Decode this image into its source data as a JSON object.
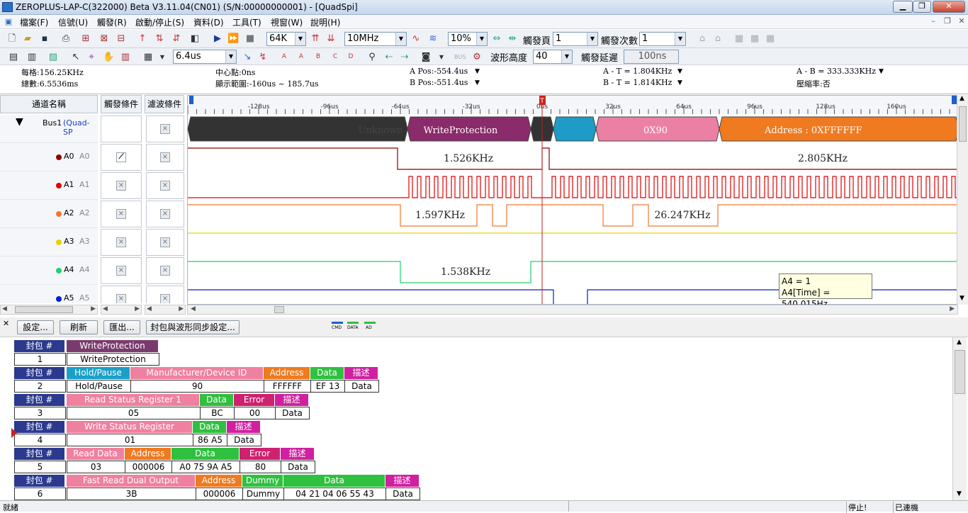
{
  "window": {
    "title": "ZEROPLUS-LAP-C(322000) Beta V3.11.04(CN01) (S/N:00000000001) - [QuadSpi]"
  },
  "menu": [
    "檔案(F)",
    "信號(U)",
    "觸發(R)",
    "啟動/停止(S)",
    "資料(D)",
    "工具(T)",
    "視窗(W)",
    "說明(H)"
  ],
  "toolbar": {
    "memory": "64K",
    "samplerate": "10MHz",
    "zoom": "10%",
    "trigger_page_label": "觸發頁",
    "trigger_page": "1",
    "trigger_count_label": "觸發次數",
    "trigger_count": "1",
    "time_per_div": "6.4us",
    "wave_height_label": "波形高度",
    "wave_height": "40",
    "trigger_delay_label": "觸發延遲",
    "trigger_delay": "100ns"
  },
  "info": {
    "period": "每格:156.25KHz",
    "total": "總數:6.5536ms",
    "center": "中心點:0ns",
    "range": "顯示範圍:-160us ~ 185.7us",
    "apos": "A Pos:-554.4us",
    "bpos": "B Pos:-551.4us",
    "at": "A - T = 1.804KHz",
    "bt": "B - T = 1.814KHz",
    "ab": "A - B = 333.333KHz",
    "compress": "壓縮率:否"
  },
  "columns": {
    "name": "通道名稱",
    "trigger": "觸發條件",
    "filter": "濾波條件"
  },
  "bus": {
    "name": "Bus1",
    "type": "(Quad-SP"
  },
  "channels": [
    {
      "label": "A0",
      "alias": "A0",
      "color": "#8b0000"
    },
    {
      "label": "A1",
      "alias": "A1",
      "color": "#e00000"
    },
    {
      "label": "A2",
      "alias": "A2",
      "color": "#f07830"
    },
    {
      "label": "A3",
      "alias": "A3",
      "color": "#e8d000"
    },
    {
      "label": "A4",
      "alias": "A4",
      "color": "#20d070"
    },
    {
      "label": "A5",
      "alias": "A5",
      "color": "#0020d0"
    }
  ],
  "ruler": [
    "-128us",
    "-96us",
    "-64us",
    "-32us",
    "0us",
    "32us",
    "64us",
    "96us",
    "128us",
    "160us"
  ],
  "ruler_values_us": [
    -128,
    -96,
    -64,
    -32,
    0,
    32,
    64,
    96,
    128,
    160
  ],
  "bus_segments": [
    "Unknown",
    "WriteProtection",
    "0X90",
    "Address : 0XFFFFFF"
  ],
  "freq_labels": {
    "a0_left": "1.526KHz",
    "a0_right": "2.805KHz",
    "a2_left": "1.597KHz",
    "a2_right": "26.247KHz",
    "a4": "1.538KHz"
  },
  "tooltip": {
    "line1": "A4 = 1",
    "line2": "A4[Time] = 540.015Hz"
  },
  "lower": {
    "settings": "設定...",
    "refresh": "刷新",
    "export": "匯出...",
    "sync": "封包與波形同步設定...",
    "legend": [
      "CMD",
      "DATA",
      "AD"
    ]
  },
  "packet_header": "封包 #",
  "packets": [
    {
      "no": "1",
      "heads": [
        [
          "WriteProtection",
          "#7b3a6e",
          130
        ]
      ],
      "vals": [
        "WriteProtection"
      ]
    },
    {
      "no": "2",
      "heads": [
        [
          "Hold/Pause",
          "#1aa0c8",
          90
        ],
        [
          "Manufacturer/Device ID",
          "#f080a0",
          188
        ],
        [
          "Address",
          "#f07a20",
          66
        ],
        [
          "Data",
          "#30c040",
          48
        ],
        [
          "描述",
          "#d020a0",
          48
        ]
      ],
      "vals": [
        "Hold/Pause",
        "90",
        "FFFFFF",
        "EF   13",
        "Data"
      ]
    },
    {
      "no": "3",
      "heads": [
        [
          "Read Status Register 1",
          "#f080a0",
          188
        ],
        [
          "Data",
          "#30c040",
          48
        ],
        [
          "Error",
          "#d02070",
          58
        ],
        [
          "描述",
          "#d020a0",
          48
        ]
      ],
      "vals": [
        "05",
        "BC",
        "00",
        "Data"
      ]
    },
    {
      "no": "4",
      "heads": [
        [
          "Write Status Register",
          "#f080a0",
          178
        ],
        [
          "Data",
          "#30c040",
          48
        ],
        [
          "描述",
          "#d020a0",
          48
        ]
      ],
      "vals": [
        "01",
        "86   A5",
        "Data"
      ]
    },
    {
      "no": "5",
      "heads": [
        [
          "Read Data",
          "#f080a0",
          82
        ],
        [
          "Address",
          "#f07a20",
          66
        ],
        [
          "Data",
          "#30c040",
          96
        ],
        [
          "Error",
          "#d02070",
          58
        ],
        [
          "描述",
          "#d020a0",
          48
        ]
      ],
      "vals": [
        "03",
        "000006",
        "A0   75   9A   A5",
        "80",
        "Data"
      ]
    },
    {
      "no": "6",
      "heads": [
        [
          "Fast Read Dual Output",
          "#f080a0",
          182
        ],
        [
          "Address",
          "#f07a20",
          66
        ],
        [
          "Dummy",
          "#30c040",
          58
        ],
        [
          "Data",
          "#30c040",
          144
        ],
        [
          "描述",
          "#d020a0",
          48
        ]
      ],
      "vals": [
        "3B",
        "000006",
        "Dummy",
        "04   21   04   06   55   43",
        "Data"
      ]
    }
  ],
  "status": {
    "left": "就緒",
    "stop": "停止!",
    "link": "已連機"
  }
}
